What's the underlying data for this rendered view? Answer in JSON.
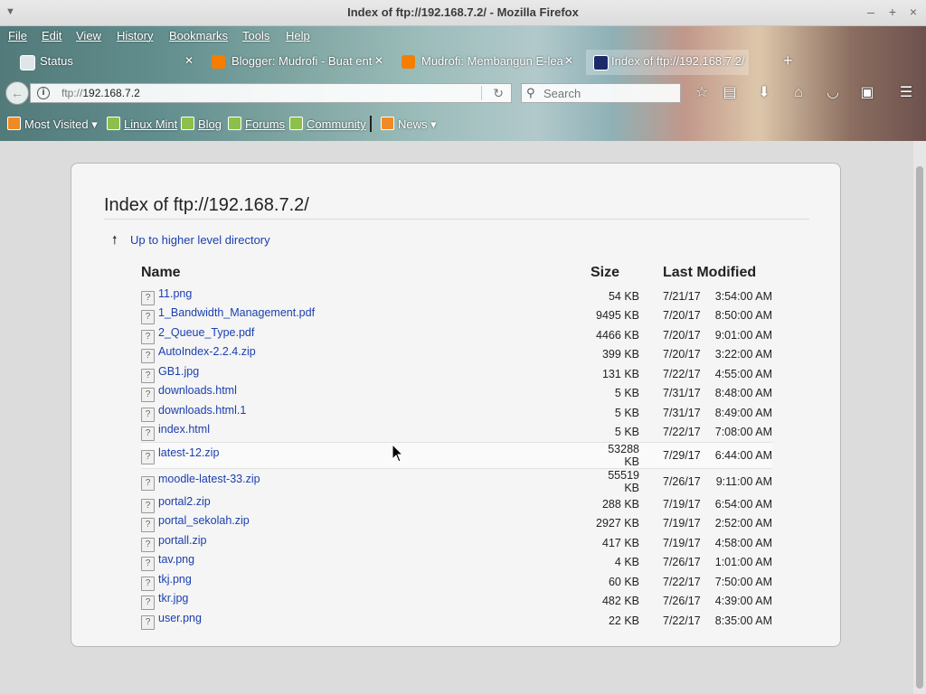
{
  "window": {
    "title": "Index of ftp://192.168.7.2/ - Mozilla Firefox",
    "controls": [
      "–",
      "+",
      "×"
    ]
  },
  "menu": [
    "File",
    "Edit",
    "View",
    "History",
    "Bookmarks",
    "Tools",
    "Help"
  ],
  "tabs": [
    {
      "label": "Status",
      "icon": "mint-icon",
      "active": false
    },
    {
      "label": "Blogger: Mudrofi - Buat ent",
      "icon": "blogger-icon",
      "active": false
    },
    {
      "label": "Mudrofi: Membangun E-lea",
      "icon": "blogger-icon",
      "active": false
    },
    {
      "label": "Index of ftp://192.168.7.2/",
      "icon": "ftp-icon",
      "active": true
    }
  ],
  "nav": {
    "url_protocol": "ftp://",
    "url_host": "192.168.7.2",
    "search_placeholder": "Search"
  },
  "bookmarks": [
    {
      "label": "Most Visited",
      "has_menu": true
    },
    {
      "label": "Linux Mint"
    },
    {
      "label": "Blog"
    },
    {
      "label": "Forums"
    },
    {
      "label": "Community"
    },
    {
      "label": "News",
      "has_menu": true
    }
  ],
  "page": {
    "heading": "Index of ftp://192.168.7.2/",
    "up_link": "Up to higher level directory",
    "columns": {
      "name": "Name",
      "size": "Size",
      "modified": "Last Modified"
    },
    "files": [
      {
        "name": "11.png",
        "size": "54 KB",
        "date": "7/21/17",
        "time": "3:54:00 AM"
      },
      {
        "name": "1_Bandwidth_Management.pdf",
        "size": "9495 KB",
        "date": "7/20/17",
        "time": "8:50:00 AM"
      },
      {
        "name": "2_Queue_Type.pdf",
        "size": "4466 KB",
        "date": "7/20/17",
        "time": "9:01:00 AM"
      },
      {
        "name": "AutoIndex-2.2.4.zip",
        "size": "399 KB",
        "date": "7/20/17",
        "time": "3:22:00 AM"
      },
      {
        "name": "GB1.jpg",
        "size": "131 KB",
        "date": "7/22/17",
        "time": "4:55:00 AM"
      },
      {
        "name": "downloads.html",
        "size": "5 KB",
        "date": "7/31/17",
        "time": "8:48:00 AM"
      },
      {
        "name": "downloads.html.1",
        "size": "5 KB",
        "date": "7/31/17",
        "time": "8:49:00 AM"
      },
      {
        "name": "index.html",
        "size": "5 KB",
        "date": "7/22/17",
        "time": "7:08:00 AM"
      },
      {
        "name": "latest-12.zip",
        "size": "53288 KB",
        "date": "7/29/17",
        "time": "6:44:00 AM"
      },
      {
        "name": "moodle-latest-33.zip",
        "size": "55519 KB",
        "date": "7/26/17",
        "time": "9:11:00 AM"
      },
      {
        "name": "portal2.zip",
        "size": "288 KB",
        "date": "7/19/17",
        "time": "6:54:00 AM"
      },
      {
        "name": "portal_sekolah.zip",
        "size": "2927 KB",
        "date": "7/19/17",
        "time": "2:52:00 AM"
      },
      {
        "name": "portall.zip",
        "size": "417 KB",
        "date": "7/19/17",
        "time": "4:58:00 AM"
      },
      {
        "name": "tav.png",
        "size": "4 KB",
        "date": "7/26/17",
        "time": "1:01:00 AM"
      },
      {
        "name": "tkj.png",
        "size": "60 KB",
        "date": "7/22/17",
        "time": "7:50:00 AM"
      },
      {
        "name": "tkr.jpg",
        "size": "482 KB",
        "date": "7/26/17",
        "time": "4:39:00 AM"
      },
      {
        "name": "user.png",
        "size": "22 KB",
        "date": "7/22/17",
        "time": "8:35:00 AM"
      }
    ]
  },
  "colors": {
    "link": "#1a3fb0",
    "panel": "#f5f5f5",
    "page_bg": "#dcdcdc"
  }
}
